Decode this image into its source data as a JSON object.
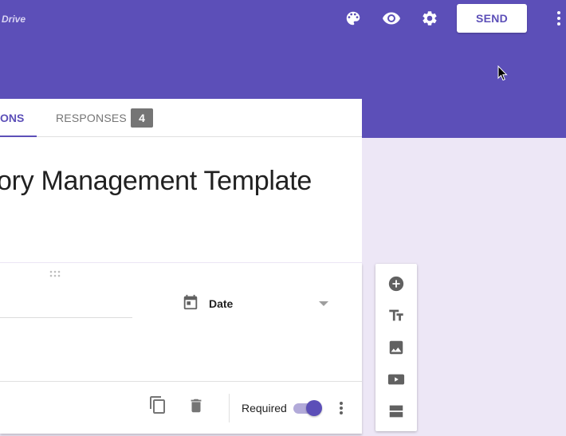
{
  "header": {
    "drive_label": "Drive",
    "send_label": "SEND",
    "icons": [
      "palette-icon",
      "eye-icon",
      "gear-icon",
      "more-vert-icon"
    ],
    "accent_color": "#5c4fb8"
  },
  "tabs": {
    "questions_label": "ONS",
    "responses_label": "RESPONSES",
    "responses_count": "4"
  },
  "form": {
    "title": "ory Management Template"
  },
  "question": {
    "type_label": "Date",
    "required_label": "Required",
    "required": true
  },
  "side_toolbar": {
    "icons": [
      "add-circle-icon",
      "title-icon",
      "image-icon",
      "video-icon",
      "section-icon"
    ]
  }
}
